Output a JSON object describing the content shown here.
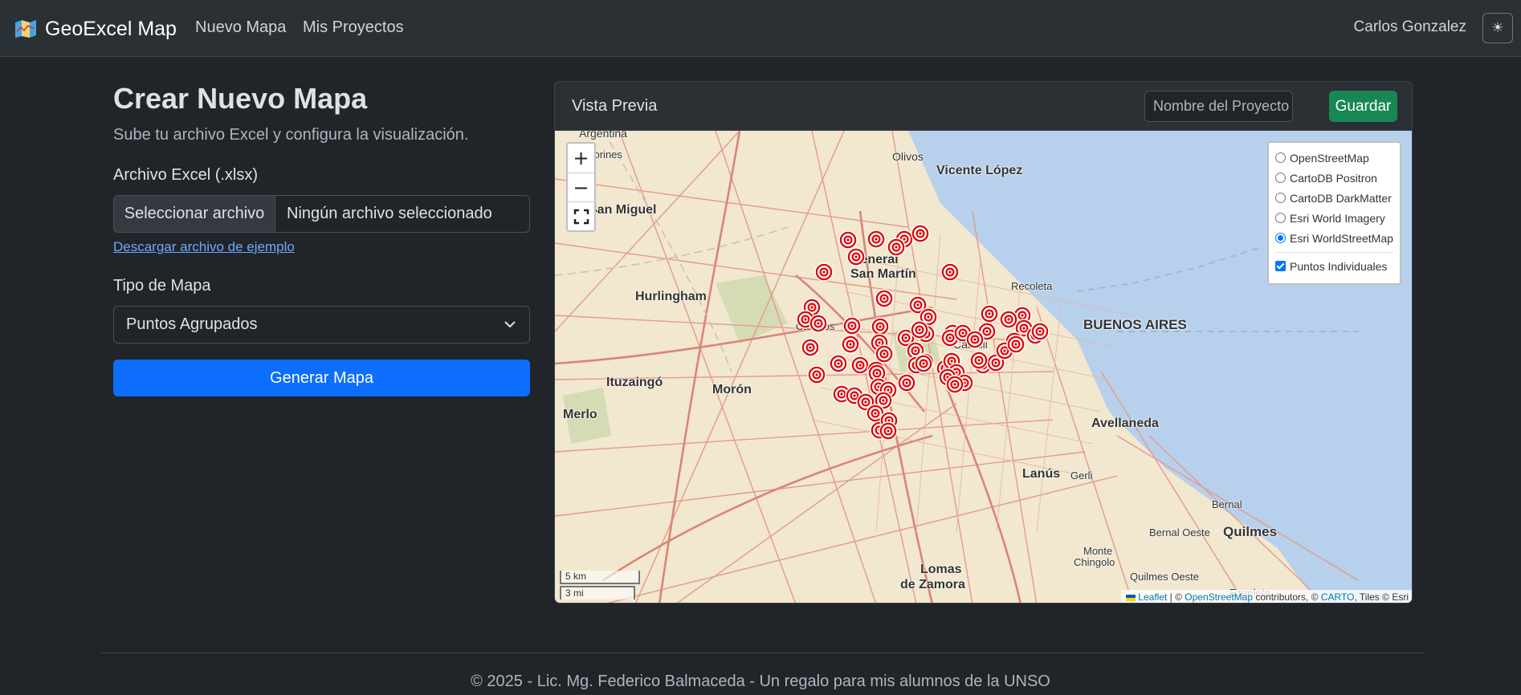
{
  "navbar": {
    "brand": "GeoExcel Map",
    "links": [
      "Nuevo Mapa",
      "Mis Proyectos"
    ],
    "user": "Carlos Gonzalez",
    "theme_icon": "sun-icon"
  },
  "form": {
    "title": "Crear Nuevo Mapa",
    "subtitle": "Sube tu archivo Excel y configura la visualización.",
    "file_label": "Archivo Excel (.xlsx)",
    "file_button": "Seleccionar archivo",
    "file_status": "Ningún archivo seleccionado",
    "sample_link": "Descargar archivo de ejemplo",
    "map_type_label": "Tipo de Mapa",
    "map_type_value": "Puntos Agrupados",
    "generate_button": "Generar Mapa"
  },
  "preview": {
    "title": "Vista Previa",
    "project_placeholder": "Nombre del Proyecto",
    "save_button": "Guardar",
    "zoom_in": "+",
    "zoom_out": "−",
    "layers": [
      "OpenStreetMap",
      "CartoDB Positron",
      "CartoDB DarkMatter",
      "Esri World Imagery",
      "Esri WorldStreetMap"
    ],
    "selected_layer": "Esri WorldStreetMap",
    "overlay": "Puntos Individuales",
    "scale_km": "5 km",
    "scale_mi": "3 mi",
    "attribution": {
      "leaflet": "Leaflet",
      "sep1": " | © ",
      "osm": "OpenStreetMap",
      "mid": " contributors, © ",
      "carto": "CARTO",
      "end": ", Tiles © Esri"
    },
    "places": {
      "vicente_lopez": "Vicente López",
      "olivos": "Olivos",
      "san_miguel": "San Miguel",
      "general_san_martin_1": "General",
      "general_san_martin_2": "San Martín",
      "hurlingham": "Hurlingham",
      "caseros": "Caseros",
      "recoleta": "Recoleta",
      "buenos_aires": "BUENOS AIRES",
      "ituzaingo": "Ituzaingó",
      "moron": "Morón",
      "merlo": "Merlo",
      "avellaneda": "Avellaneda",
      "lanus": "Lanús",
      "gerli": "Gerli",
      "bernal": "Bernal",
      "bernal_oeste": "Bernal Oeste",
      "quilmes": "Quilmes",
      "quilmes_oeste": "Quilmes Oeste",
      "monte_chingolo_1": "Monte",
      "monte_chingolo_2": "Chingolo",
      "lomas_1": "Lomas",
      "lomas_2": "de Zamora",
      "caballito": "Caballi",
      "argentina": "Argentina",
      "los_polvorines": "vorines",
      "ezpeleta": "Ezpeleta"
    }
  },
  "footer": {
    "text": "© 2025 - Lic. Mg. Federico Balmaceda - Un regalo para mis alumnos de la UNSO"
  }
}
